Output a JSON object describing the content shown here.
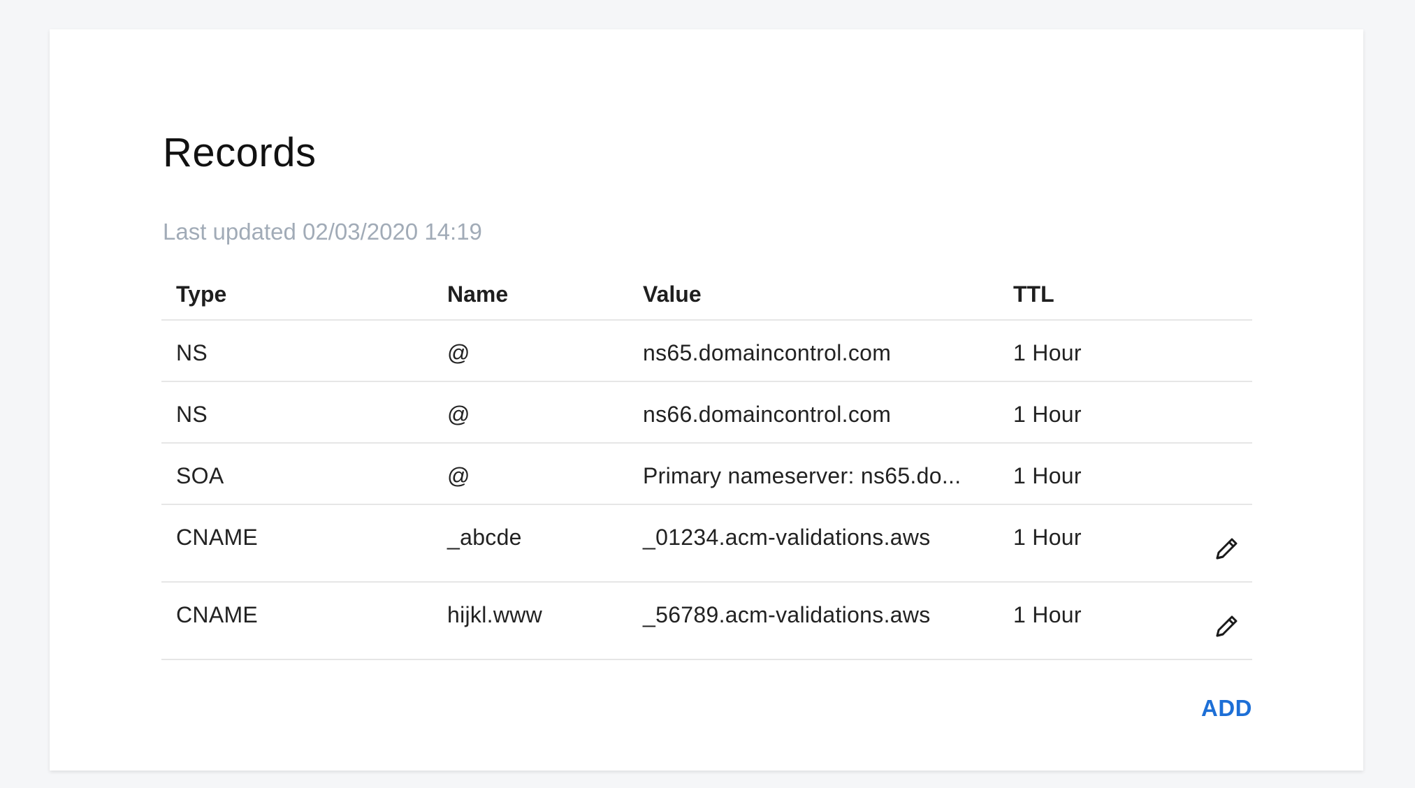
{
  "page": {
    "title": "Records",
    "last_updated": "Last updated 02/03/2020 14:19"
  },
  "table": {
    "headers": {
      "type": "Type",
      "name": "Name",
      "value": "Value",
      "ttl": "TTL"
    },
    "rows": [
      {
        "type": "NS",
        "name": "@",
        "value": "ns65.domaincontrol.com",
        "ttl": "1 Hour",
        "editable": false
      },
      {
        "type": "NS",
        "name": "@",
        "value": "ns66.domaincontrol.com",
        "ttl": "1 Hour",
        "editable": false
      },
      {
        "type": "SOA",
        "name": "@",
        "value": "Primary nameserver: ns65.do...",
        "ttl": "1 Hour",
        "editable": false
      },
      {
        "type": "CNAME",
        "name": "_abcde",
        "value": "_01234.acm-validations.aws",
        "ttl": "1 Hour",
        "editable": true,
        "edit_icon": "pencil-icon"
      },
      {
        "type": "CNAME",
        "name": "hijkl.www",
        "value": "_56789.acm-validations.aws",
        "ttl": "1 Hour",
        "editable": true,
        "edit_icon": "pencil-icon"
      }
    ]
  },
  "actions": {
    "add_label": "ADD"
  },
  "colors": {
    "accent": "#1d6fd6",
    "muted_text": "#a1abb7",
    "divider": "#e6e6e6"
  }
}
